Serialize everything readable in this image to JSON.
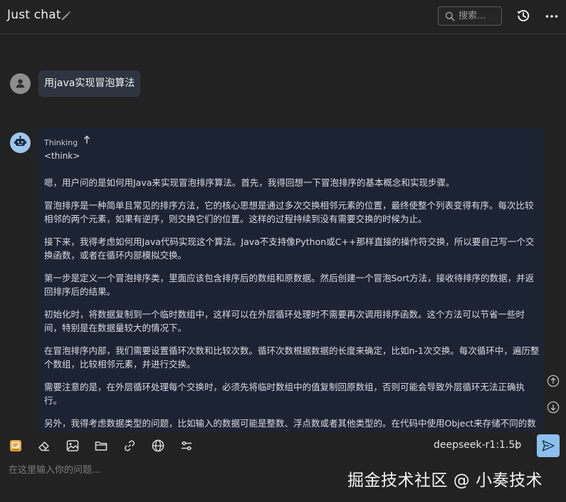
{
  "header": {
    "title": "Just chat",
    "search_placeholder": "搜索..."
  },
  "user_message": {
    "text": "用java实现冒泡算法"
  },
  "assistant_message": {
    "thinking_label": "Thinking",
    "think_tag": "<think>",
    "paragraphs": [
      "嗯，用户问的是如何用Java来实现冒泡排序算法。首先，我得回想一下冒泡排序的基本概念和实现步骤。",
      "冒泡排序是一种简单且常见的排序方法，它的核心思想是通过多次交换相邻元素的位置，最终使整个列表变得有序。每次比较相邻的两个元素，如果有逆序，则交换它们的位置。这样的过程持续到没有需要交换的时候为止。",
      "接下来，我得考虑如何用Java代码实现这个算法。Java不支持像Python或C++那样直接的操作符交换，所以要自己写一个交换函数，或者在循环内部模拟交换。",
      "第一步是定义一个冒泡排序类，里面应该包含排序后的数组和原数据。然后创建一个冒泡Sort方法，接收待排序的数据，并返回排序后的结果。",
      "初始化时，将数据复制到一个临时数组中，这样可以在外层循环处理时不需要再次调用排序函数。这个方法可以节省一些时间，特别是在数据量较大的情况下。",
      "在冒泡排序内部，我们需要设置循环次数和比较次数。循环次数根据数据的长度来确定，比如n-1次交换。每次循环中，遍历整个数组，比较相邻元素，并进行交换。",
      "需要注意的是，在外层循环处理每个交换时，必须先将临时数组中的值复制回原数组，否则可能会导致外层循环无法正确执行。",
      "另外，我得考虑数据类型的问题，比如输入的数据可能是整数、浮点数或者其他类型的。在代码中使用Object来存储不同的数据类型会比较方便。"
    ]
  },
  "footer": {
    "model_name": "deepseek-r1:1.5b",
    "input_placeholder": "在这里输入你的问题...",
    "watermark": "掘金技术社区 @ 小奏技术"
  },
  "colors": {
    "background": "#222222",
    "card": "#1c2434",
    "user_bubble": "#2f3540",
    "accent": "#8cc0ee"
  }
}
